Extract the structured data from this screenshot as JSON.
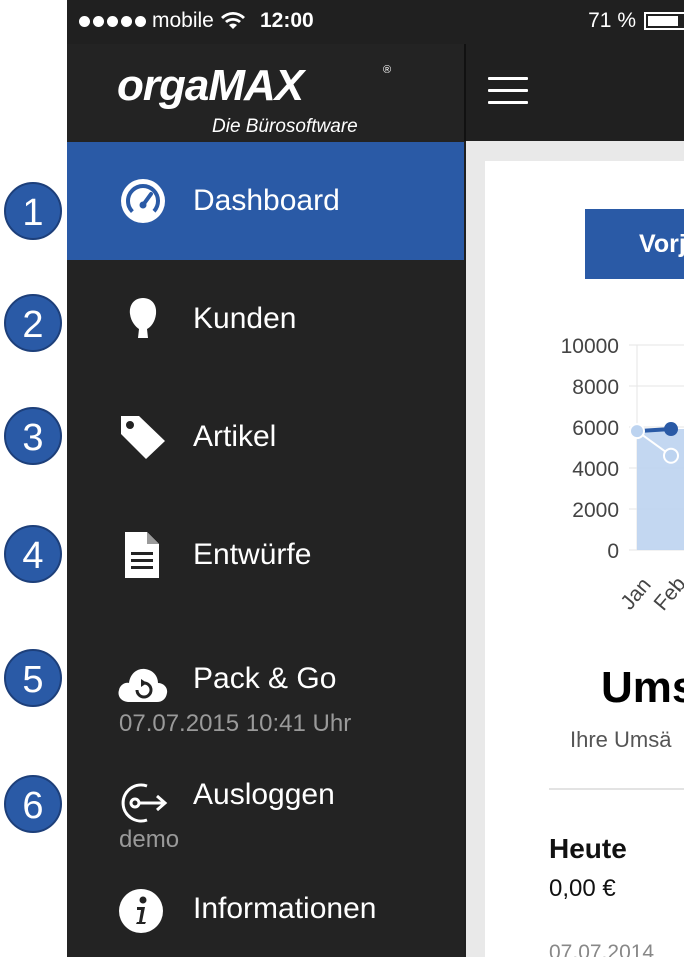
{
  "statusbar": {
    "signal_dots": 5,
    "carrier": "mobile",
    "time": "12:00",
    "battery_pct_label": "71 %",
    "battery_level": 0.71
  },
  "logo": {
    "word": "orgaMAX",
    "tagline": "Die Bürosoftware",
    "reg": "®"
  },
  "menu": [
    {
      "label": "Dashboard",
      "icon": "gauge-icon",
      "active": true
    },
    {
      "label": "Kunden",
      "icon": "person-head-icon"
    },
    {
      "label": "Artikel",
      "icon": "tag-icon"
    },
    {
      "label": "Entwürfe",
      "icon": "document-icon"
    },
    {
      "label": "Pack & Go",
      "icon": "cloud-sync-icon",
      "sub": "07.07.2015 10:41 Uhr"
    },
    {
      "label": "Ausloggen",
      "icon": "logout-icon",
      "sub": "demo"
    },
    {
      "label": "Informationen",
      "icon": "info-icon"
    }
  ],
  "badges": [
    "1",
    "2",
    "3",
    "4",
    "5",
    "6"
  ],
  "main": {
    "button_label": "Vorj",
    "title": "Ums",
    "subtitle": "Ihre Umsä",
    "today_label": "Heute",
    "today_value": "0,00 €",
    "date_cut": "07.07.2014"
  },
  "chart_data": {
    "type": "area",
    "ylim": [
      0,
      10000
    ],
    "yticks": [
      "10000",
      "8000",
      "6000",
      "4000",
      "2000",
      "0"
    ],
    "categories": [
      "Jan",
      "Feb"
    ],
    "series": [
      {
        "values": [
          5800,
          5900
        ]
      },
      {
        "values": [
          5800,
          4600
        ]
      }
    ]
  },
  "colors": {
    "accent": "#2a5aa6",
    "sidebar": "#232323",
    "area_fill": "#bcd3f0"
  }
}
